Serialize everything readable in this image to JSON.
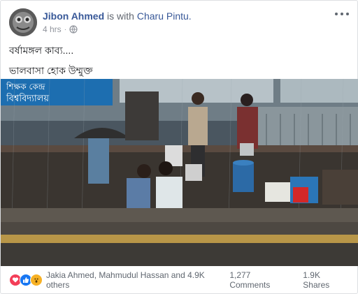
{
  "post": {
    "author": "Jibon Ahmed",
    "with_text": " is with ",
    "tagged": "Charu Pintu.",
    "time": "4 hrs",
    "separator": "·",
    "privacy_icon": "globe-icon",
    "text_lines": [
      "বর্ষামঙ্গল কাব্য....",
      "ভালবাসা হোক উম্মুক্ত"
    ],
    "photo_signs": {
      "sign_line_1": "শিক্ষক কেন্দ্র",
      "sign_line_2": "বিশ্ববিদ্যালয়"
    }
  },
  "footer": {
    "reaction_icons": [
      "love-icon",
      "like-icon",
      "wow-icon"
    ],
    "reaction_names": "Jakia Ahmed, Mahmudul Hassan and 4.9K others",
    "comments": "1,277 Comments",
    "shares": "1.9K Shares"
  },
  "colors": {
    "link": "#385898",
    "secondary": "#90949c",
    "like_blue": "#1877f2",
    "love_red": "#f33e58",
    "wow_yellow": "#f7b125"
  }
}
